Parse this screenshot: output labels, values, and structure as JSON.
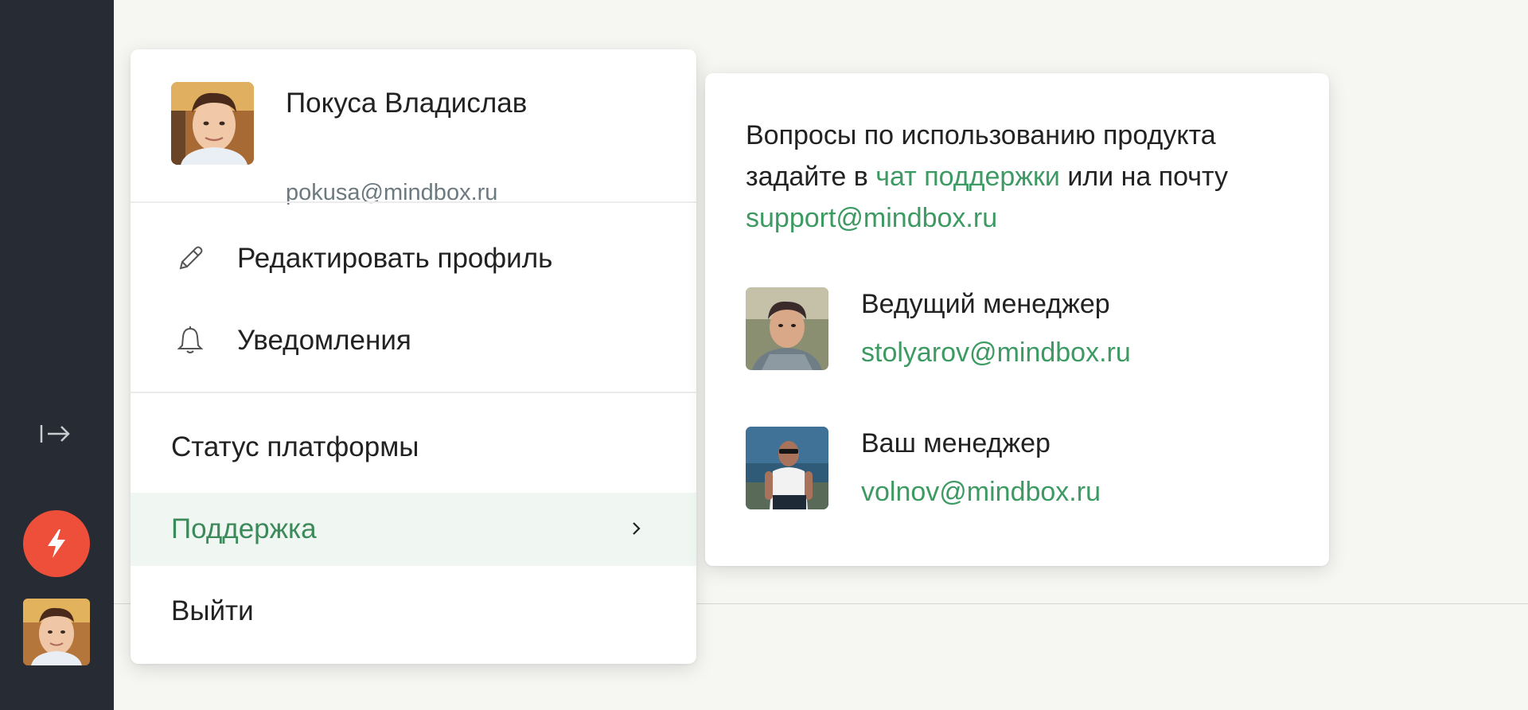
{
  "sidebar": {
    "collapse_icon": "collapse-right-icon",
    "quick_action_icon": "lightning-icon",
    "accent_color": "#ee4f3a"
  },
  "profile": {
    "name": "Покуса Владислав",
    "email": "pokusa@mindbox.ru"
  },
  "menu": {
    "items": [
      {
        "label": "Редактировать профиль",
        "icon": "pencil-icon"
      },
      {
        "label": "Уведомления",
        "icon": "bell-icon"
      }
    ],
    "secondary": [
      {
        "label": "Статус платформы"
      },
      {
        "label": "Поддержка",
        "active": true,
        "icon": "chevron-right-icon"
      },
      {
        "label": "Выйти"
      }
    ]
  },
  "support": {
    "text_part1": "Вопросы по использованию продукта задайте в ",
    "chat_link": "чат поддержки",
    "text_part2": " или на почту ",
    "support_email": "support@mindbox.ru",
    "managers": [
      {
        "role": "Ведущий менеджер",
        "email": "stolyarov@mindbox.ru"
      },
      {
        "role": "Ваш менеджер",
        "email": "volnov@mindbox.ru"
      }
    ],
    "link_color": "#3c9a62"
  }
}
